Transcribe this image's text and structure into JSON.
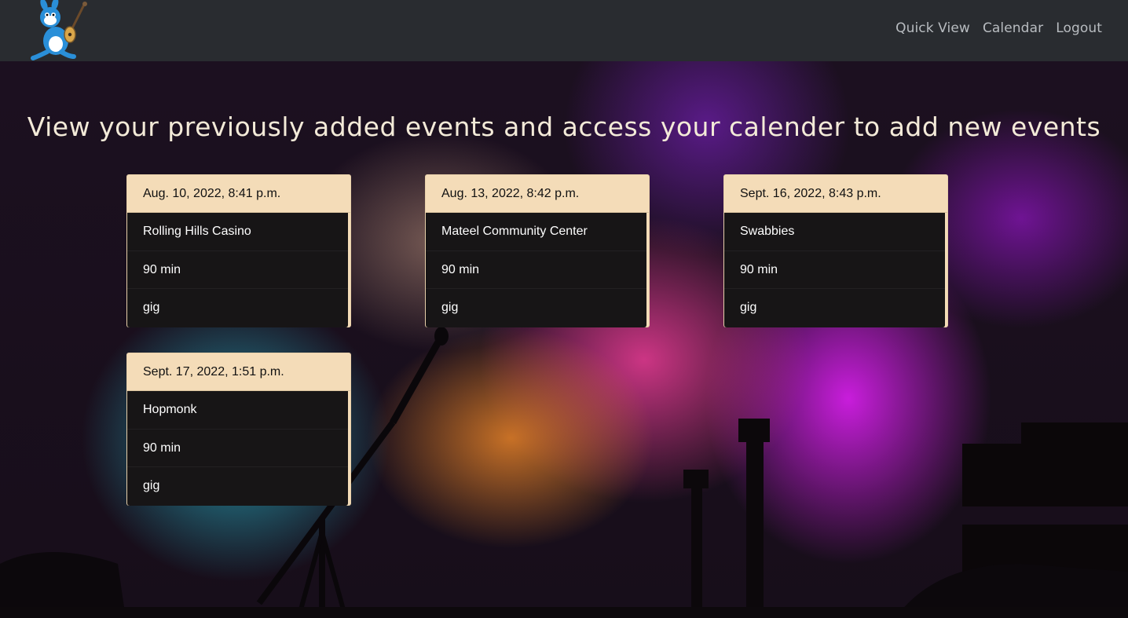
{
  "nav": {
    "links": [
      "Quick View",
      "Calendar",
      "Logout"
    ]
  },
  "hero": {
    "title": "View your previously added events and access your calender to add new events"
  },
  "events": [
    {
      "date": "Aug. 10, 2022, 8:41 p.m.",
      "venue": "Rolling Hills Casino",
      "duration": "90 min",
      "type": "gig"
    },
    {
      "date": "Aug. 13, 2022, 8:42 p.m.",
      "venue": "Mateel Community Center",
      "duration": "90 min",
      "type": "gig"
    },
    {
      "date": "Sept. 16, 2022, 8:43 p.m.",
      "venue": "Swabbies",
      "duration": "90 min",
      "type": "gig"
    },
    {
      "date": "Sept. 17, 2022, 1:51 p.m.",
      "venue": "Hopmonk",
      "duration": "90 min",
      "type": "gig"
    }
  ],
  "colors": {
    "navbar": "#292c30",
    "card_header": "#f4dcb8",
    "card_body": "#171516",
    "title_text": "#f3ead8"
  }
}
